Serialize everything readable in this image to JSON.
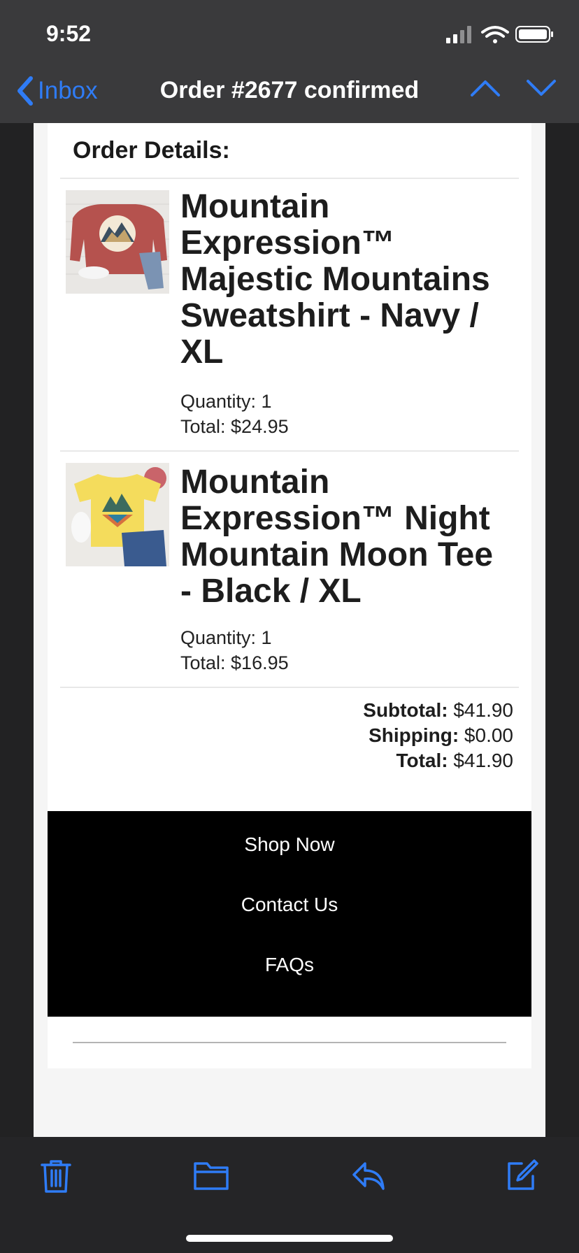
{
  "status_bar": {
    "time": "9:52"
  },
  "nav": {
    "back_label": "Inbox",
    "title": "Order #2677 confirmed"
  },
  "email": {
    "section_title": "Order Details:",
    "items": [
      {
        "name": "Mountain Expression™ Majestic Mountains Sweatshirt - Navy / XL",
        "quantity": "Quantity: 1",
        "total": "Total: $24.95"
      },
      {
        "name": "Mountain Expression™ Night Mountain Moon Tee - Black / XL",
        "quantity": "Quantity: 1",
        "total": "Total: $16.95"
      }
    ],
    "totals": {
      "subtotal_label": "Subtotal:",
      "subtotal_value": "$41.90",
      "shipping_label": "Shipping:",
      "shipping_value": "$0.00",
      "total_label": "Total:",
      "total_value": "$41.90"
    },
    "footer_links": [
      "Shop Now",
      "Contact Us",
      "FAQs"
    ]
  },
  "toolbar": {
    "icons": [
      "trash-icon",
      "folder-icon",
      "reply-icon",
      "compose-icon"
    ]
  },
  "colors": {
    "accent": "#2f7cf6",
    "header_bg": "#3a3a3c",
    "footer_bg": "#000000"
  }
}
